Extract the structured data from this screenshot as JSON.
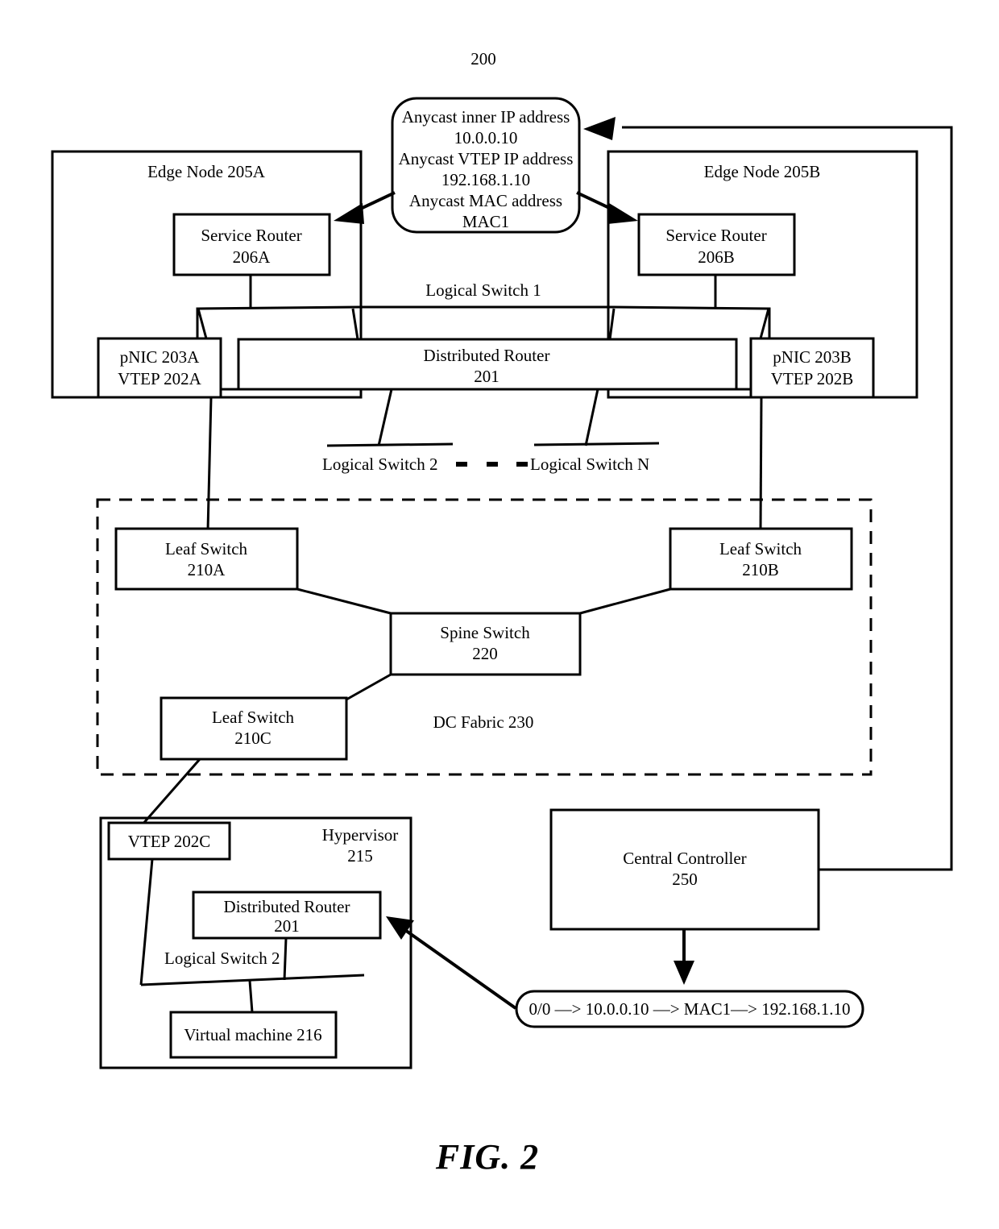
{
  "figure": {
    "reference_numeral": "200",
    "caption": "FIG. 2"
  },
  "anycast_callout": {
    "name": "anycast-address-callout",
    "lines": [
      "Anycast inner IP address",
      "10.0.0.10",
      "Anycast VTEP IP address",
      "192.168.1.10",
      "Anycast MAC address",
      "MAC1"
    ],
    "inner_ip_label": "Anycast inner IP address",
    "inner_ip_value": "10.0.0.10",
    "vtep_ip_label": "Anycast VTEP IP address",
    "vtep_ip_value": "192.168.1.10",
    "mac_label": "Anycast MAC address",
    "mac_value": "MAC1"
  },
  "edge_node_a": {
    "title": "Edge Node 205A",
    "service_router_line1": "Service Router",
    "service_router_line2": "206A",
    "pnic_line1": "pNIC 203A",
    "pnic_line2": "VTEP 202A"
  },
  "edge_node_b": {
    "title": "Edge Node 205B",
    "service_router_line1": "Service Router",
    "service_router_line2": "206B",
    "pnic_line1": "pNIC 203B",
    "pnic_line2": "VTEP 202B"
  },
  "logical_switch_1": {
    "label": "Logical Switch 1"
  },
  "distributed_router_top": {
    "line1": "Distributed Router",
    "line2": "201"
  },
  "logical_switches_row": {
    "switch_2_label": "Logical Switch 2",
    "switch_n_label": "Logical Switch N",
    "ellipsis": "- - -"
  },
  "dc_fabric": {
    "label": "DC Fabric 230",
    "leaf_a_line1": "Leaf Switch",
    "leaf_a_line2": "210A",
    "leaf_b_line1": "Leaf Switch",
    "leaf_b_line2": "210B",
    "leaf_c_line1": "Leaf Switch",
    "leaf_c_line2": "210C",
    "spine_line1": "Spine Switch",
    "spine_line2": "220"
  },
  "hypervisor": {
    "title_line1": "Hypervisor",
    "title_line2": "215",
    "vtep_label": "VTEP 202C",
    "distributed_router_line1": "Distributed Router",
    "distributed_router_line2": "201",
    "logical_switch_2_label": "Logical Switch 2",
    "virtual_machine_label": "Virtual machine 216"
  },
  "central_controller": {
    "line1": "Central Controller",
    "line2": "250"
  },
  "route_rule_callout": {
    "text": "0/0 —> 10.0.0.10 —> MAC1—> 192.168.1.10"
  },
  "colors": {
    "stroke": "#000000",
    "background": "#ffffff"
  }
}
